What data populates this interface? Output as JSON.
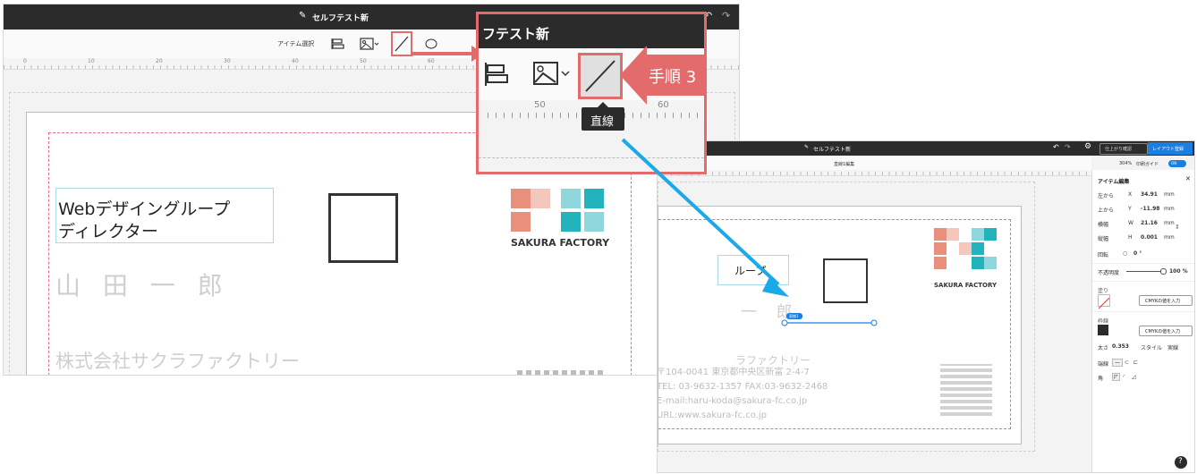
{
  "left_editor": {
    "doc_title": "セルフテスト新",
    "toolbar_label": "アイテム選択",
    "ruler_ticks": [
      "0",
      "10",
      "20",
      "30",
      "40",
      "50",
      "60"
    ],
    "card": {
      "title_line1": "Webデザイングループ",
      "title_line2": "ディレクター",
      "name": "山 田 一 郎",
      "company": "株式会社サクラファクトリー",
      "logo_text": "SAKURA FACTORY"
    }
  },
  "callout": {
    "title": "フテスト新",
    "ruler_ticks": [
      "50",
      "60"
    ],
    "tooltip": "直線",
    "step_label": "手順 3"
  },
  "right_editor": {
    "doc_title": "セルフテスト新",
    "preview_button": "仕上がり確認",
    "layout_button": "レイアウト登録",
    "toolbar_label": "直線1編集",
    "zoom": "304%",
    "print_guide": "印刷ガイド",
    "print_guide_toggle": "ON",
    "card": {
      "title_partial": "ループ",
      "name_partial": "一 郎",
      "company_partial": "ラファクトリー",
      "address": "〒104-0041 東京都中央区新富 2-4-7",
      "tel": "TEL: 03-9632-1357  FAX:03-9632-2468",
      "email": "E-mail:haru-koda@sakura-fc.co.jp",
      "url": "URL:www.sakura-fc.co.jp",
      "logo_text": "SAKURA FACTORY",
      "line_badge": "直線1"
    },
    "panel": {
      "title": "アイテム編集",
      "rows": [
        {
          "label": "左から",
          "axis": "X",
          "value": "34.91",
          "unit": "mm"
        },
        {
          "label": "上から",
          "axis": "Y",
          "value": "-11.98",
          "unit": "mm"
        },
        {
          "label": "横幅",
          "axis": "W",
          "value": "21.16",
          "unit": "mm"
        },
        {
          "label": "縦幅",
          "axis": "H",
          "value": "0.001",
          "unit": "mm"
        }
      ],
      "rotate_label": "回転",
      "rotate_value": "0 °",
      "opacity_label": "不透明度",
      "opacity_value": "100 %",
      "fill_label": "塗り",
      "fill_button": "CMYKの値を入力",
      "stroke_label": "枠線",
      "stroke_button": "CMYKの値を入力",
      "thickness_label": "太さ",
      "thickness_value": "0.353",
      "style_label": "スタイル",
      "style_value": "実線",
      "edge_label": "端線",
      "corner_label": "角",
      "help": "?"
    }
  },
  "colors": {
    "header_dark": "#2b2b2b",
    "callout_border": "#e36b6b",
    "arrow_blue": "#1ba9e8",
    "logo_salmon": "#e9907c",
    "logo_teal": "#22b3bd",
    "accent_blue": "#1a7fe0"
  }
}
